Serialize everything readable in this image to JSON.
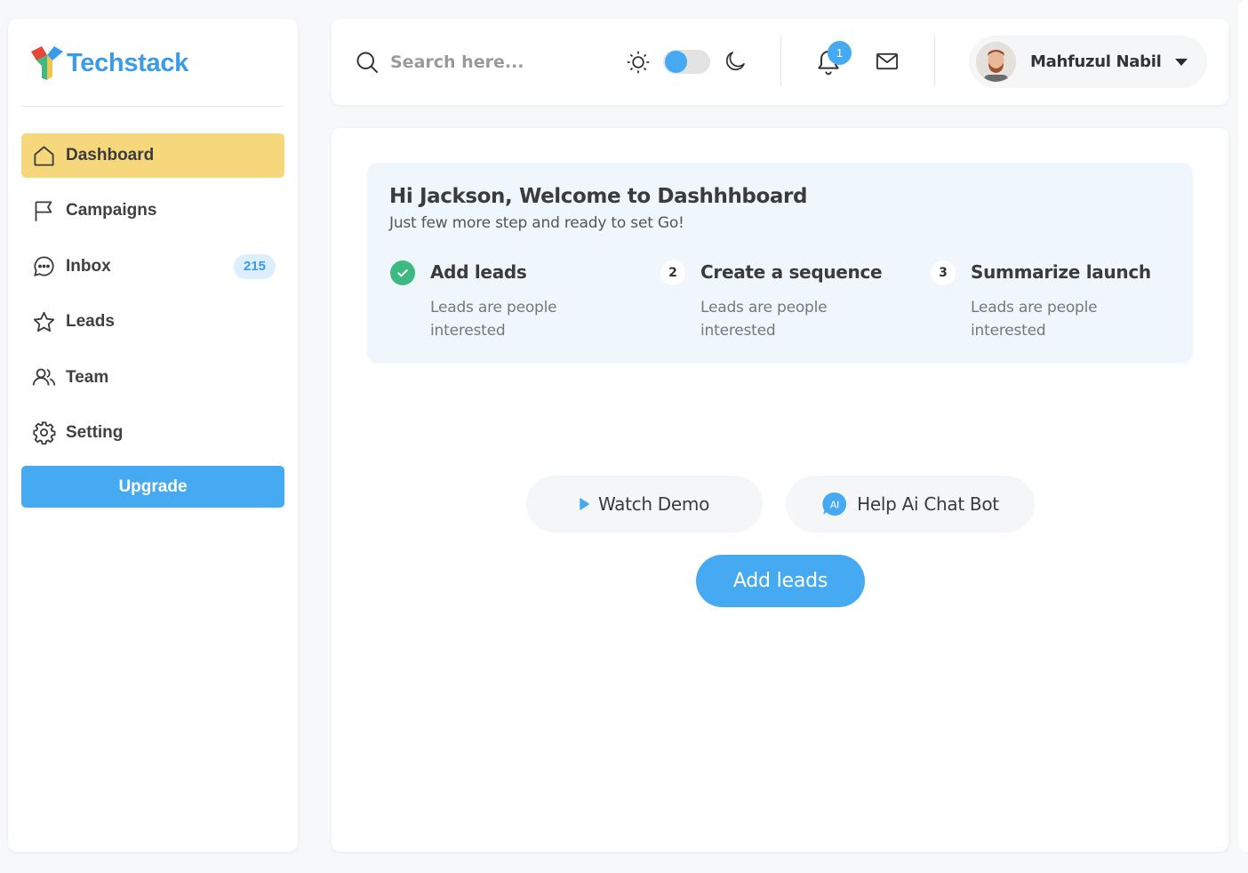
{
  "brand": {
    "name": "Techstack"
  },
  "sidebar": {
    "items": [
      {
        "label": "Dashboard",
        "icon": "home-icon",
        "active": true
      },
      {
        "label": "Campaigns",
        "icon": "flag-icon"
      },
      {
        "label": "Inbox",
        "icon": "chat-icon",
        "badge": "215"
      },
      {
        "label": "Leads",
        "icon": "star-icon"
      },
      {
        "label": "Team",
        "icon": "users-icon"
      },
      {
        "label": "Setting",
        "icon": "gear-icon"
      }
    ],
    "upgrade_label": "Upgrade"
  },
  "header": {
    "search_placeholder": "Search here...",
    "theme_toggle": "light",
    "notification_count": "1",
    "user_name": "Mahfuzul Nabil"
  },
  "welcome": {
    "title": "Hi Jackson, Welcome to Dashhhboard",
    "subtitle": "Just few more step and ready to set Go!",
    "steps": [
      {
        "marker": "done",
        "title": "Add leads",
        "desc": "Leads are people interested"
      },
      {
        "marker": "2",
        "title": "Create a sequence",
        "desc": "Leads are people interested"
      },
      {
        "marker": "3",
        "title": "Summarize launch",
        "desc": "Leads are people interested"
      }
    ]
  },
  "actions": {
    "watch_demo": "Watch Demo",
    "chat_bot": "Help Ai Chat Bot",
    "ai_badge": "AI",
    "add_leads": "Add leads"
  },
  "colors": {
    "accent": "#45aaf2",
    "active_nav": "#f7d77b",
    "success": "#3dba82",
    "welcome_bg": "#eff7fd"
  }
}
